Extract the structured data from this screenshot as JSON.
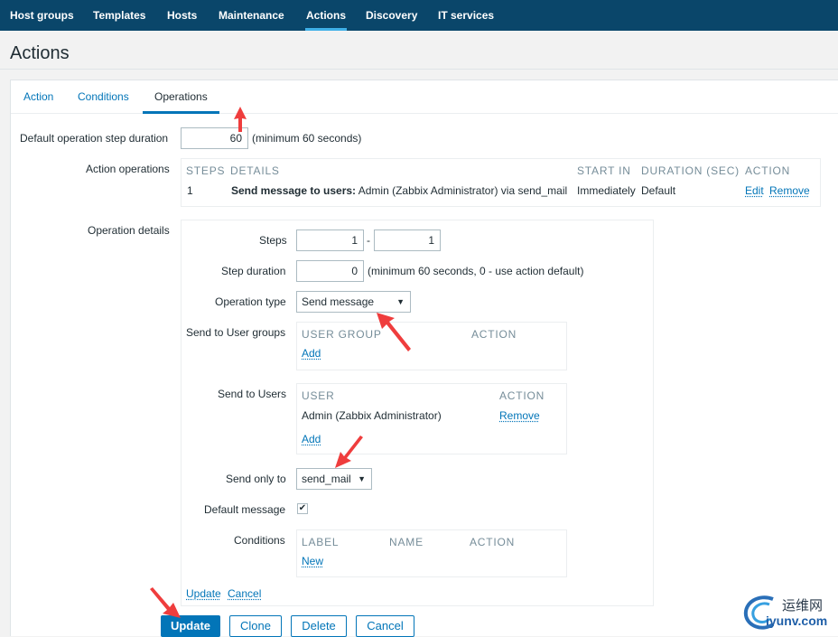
{
  "nav": {
    "items": [
      "Host groups",
      "Templates",
      "Hosts",
      "Maintenance",
      "Actions",
      "Discovery",
      "IT services"
    ],
    "active": "Actions"
  },
  "page_title": "Actions",
  "tabs": [
    "Action",
    "Conditions",
    "Operations"
  ],
  "active_tab": "Operations",
  "form": {
    "step_duration_label": "Default operation step duration",
    "step_duration_value": "60",
    "step_duration_hint": "(minimum 60 seconds)",
    "action_operations_label": "Action operations",
    "operations_table": {
      "headers": [
        "STEPS",
        "DETAILS",
        "START IN",
        "DURATION (SEC)",
        "ACTION"
      ],
      "row": {
        "steps": "1",
        "details_bold": "Send message to users:",
        "details_rest": " Admin (Zabbix Administrator) via send_mail",
        "start_in": "Immediately",
        "duration": "Default",
        "edit": "Edit",
        "remove": "Remove"
      }
    },
    "operation_details_label": "Operation details"
  },
  "details": {
    "steps_label": "Steps",
    "steps_from": "1",
    "steps_sep": "-",
    "steps_to": "1",
    "step_duration_label": "Step duration",
    "step_duration_value": "0",
    "step_duration_hint": "(minimum 60 seconds, 0 - use action default)",
    "operation_type_label": "Operation type",
    "operation_type_value": "Send message",
    "user_groups_label": "Send to User groups",
    "user_groups_headers": [
      "USER GROUP",
      "ACTION"
    ],
    "user_groups_add": "Add",
    "users_label": "Send to Users",
    "users_headers": [
      "USER",
      "ACTION"
    ],
    "users_row_name": "Admin (Zabbix Administrator)",
    "users_row_remove": "Remove",
    "users_add": "Add",
    "send_only_to_label": "Send only to",
    "send_only_to_value": "send_mail",
    "default_message_label": "Default message",
    "default_message_checked": "✔",
    "conditions_label": "Conditions",
    "conditions_headers": [
      "LABEL",
      "NAME",
      "ACTION"
    ],
    "conditions_new": "New",
    "update_link": "Update",
    "cancel_link": "Cancel"
  },
  "buttons": {
    "update": "Update",
    "clone": "Clone",
    "delete": "Delete",
    "cancel": "Cancel"
  },
  "watermark": {
    "line1": "运维网",
    "line2": "iyunv.com"
  },
  "colors": {
    "nav_bg": "#0a466a",
    "link": "#0275b8",
    "arrow": "#ef3d3d"
  },
  "icons": [
    "chevron-down-icon",
    "check-icon",
    "red-arrow-annotation"
  ]
}
